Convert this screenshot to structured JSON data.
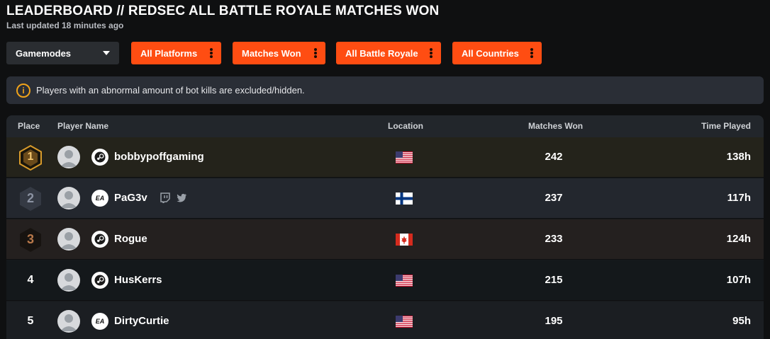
{
  "header": {
    "title": "LEADERBOARD // REDSEC ALL BATTLE ROYALE MATCHES WON",
    "last_updated": "Last updated 18 minutes ago"
  },
  "filters": {
    "gamemodes_label": "Gamemodes",
    "buttons": [
      "All Platforms",
      "Matches Won",
      "All Battle Royale",
      "All Countries"
    ],
    "accent_color": "#ff4d12"
  },
  "notice": {
    "icon": "info-icon",
    "text": "Players with an abnormal amount of bot kills are excluded/hidden."
  },
  "table": {
    "columns": {
      "place": "Place",
      "player": "Player Name",
      "location": "Location",
      "wins": "Matches Won",
      "time": "Time Played"
    },
    "rows": [
      {
        "place": "1",
        "name": "bobbypoffgaming",
        "platform": "steam-icon",
        "socials": [],
        "country": "us-flag",
        "wins": "242",
        "time": "138h"
      },
      {
        "place": "2",
        "name": "PaG3v",
        "platform": "ea-icon",
        "socials": [
          "twitch-icon",
          "twitter-icon"
        ],
        "country": "fi-flag",
        "wins": "237",
        "time": "117h"
      },
      {
        "place": "3",
        "name": "Rogue",
        "platform": "steam-icon",
        "socials": [],
        "country": "ca-flag",
        "wins": "233",
        "time": "124h"
      },
      {
        "place": "4",
        "name": "HusKerrs",
        "platform": "steam-icon",
        "socials": [],
        "country": "us-flag",
        "wins": "215",
        "time": "107h"
      },
      {
        "place": "5",
        "name": "DirtyCurtie",
        "platform": "ea-icon",
        "socials": [],
        "country": "us-flag",
        "wins": "195",
        "time": "95h"
      }
    ]
  }
}
